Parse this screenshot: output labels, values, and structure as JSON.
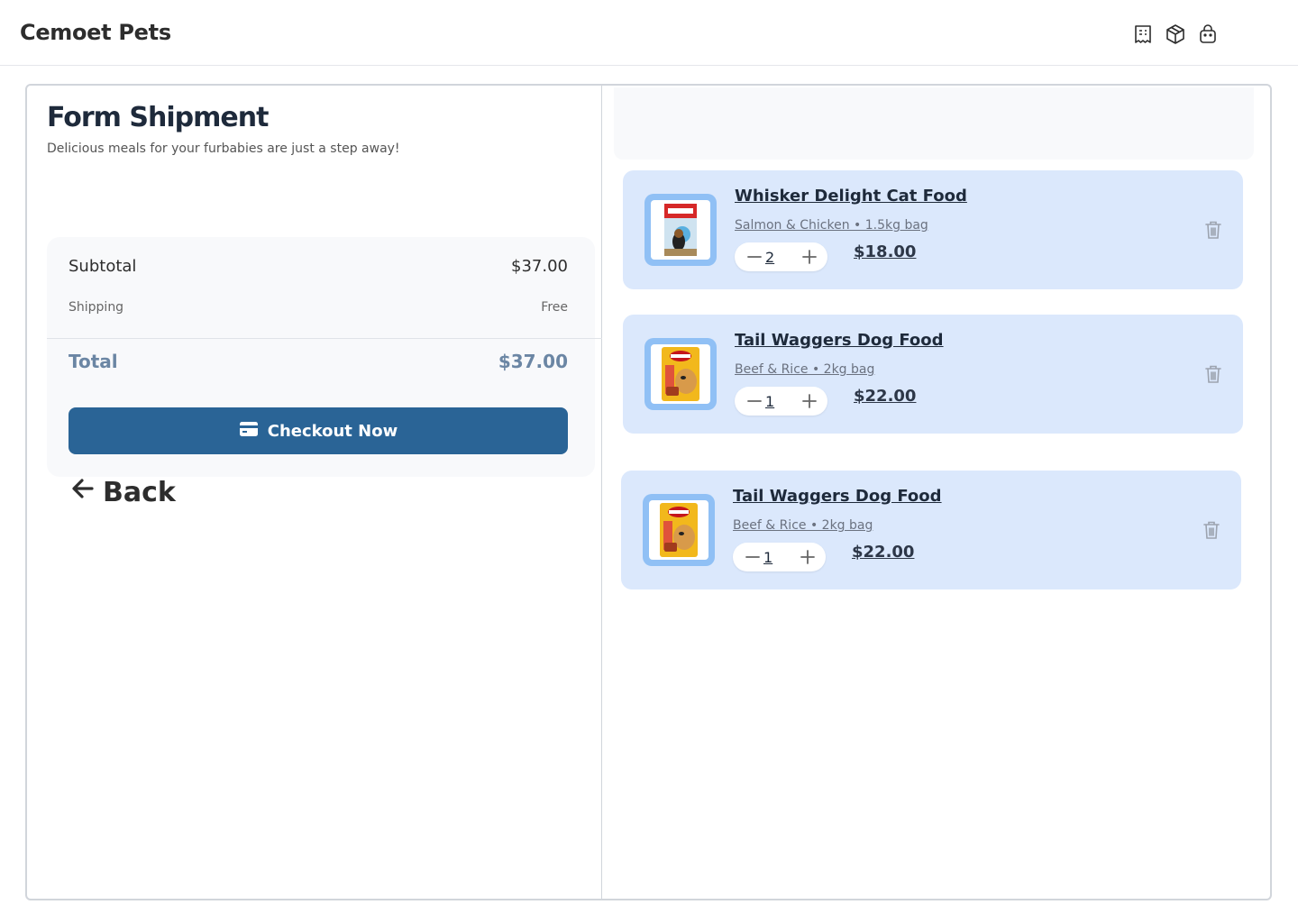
{
  "app": {
    "title": "Cemoet Pets"
  },
  "header_icons": [
    "receipt-icon",
    "package-icon",
    "shopping-bag-icon"
  ],
  "page": {
    "title": "Form Shipment",
    "subtitle": "Delicious meals for your furbabies are just a step away!"
  },
  "summary": {
    "subtotal_label": "Subtotal",
    "subtotal_value": "$37.00",
    "shipping_label": "Shipping",
    "shipping_value": "Free",
    "total_label": "Total",
    "total_value": "$37.00",
    "checkout_label": "Checkout Now"
  },
  "back_label": "Back",
  "cart": [
    {
      "name": "Whisker Delight Cat Food",
      "desc": "Salmon & Chicken • 1.5kg bag",
      "qty": "2",
      "price": "$18.00",
      "image": "royal-canin-bag"
    },
    {
      "name": "Tail Waggers Dog Food",
      "desc": "Beef & Rice • 2kg bag",
      "qty": "1",
      "price": "$22.00",
      "image": "pedigree-bag"
    },
    {
      "name": "Tail Waggers Dog Food",
      "desc": "Beef & Rice • 2kg bag",
      "qty": "1",
      "price": "$22.00",
      "image": "pedigree-bag"
    }
  ],
  "colors": {
    "primary": "#2a6496",
    "card_bg": "#dbe8fc",
    "thumb_bg": "#90c0f5",
    "total_text": "#6b86a4"
  }
}
